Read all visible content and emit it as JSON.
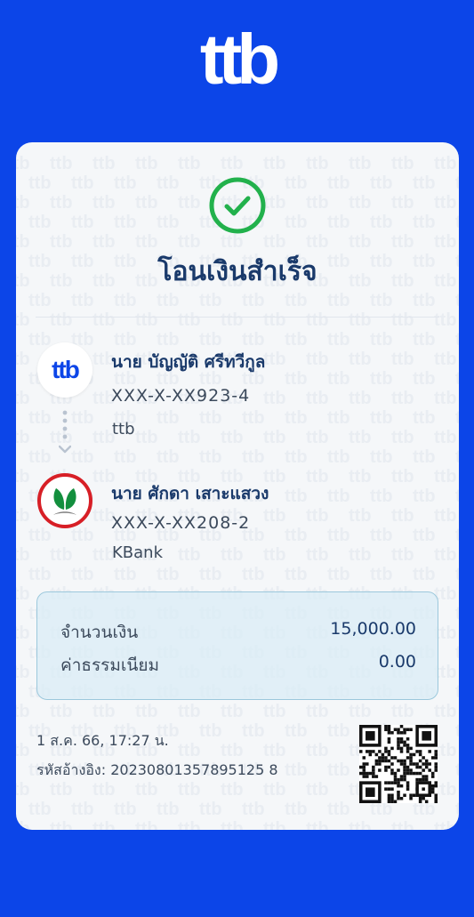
{
  "brand": {
    "logo_text": "ttb",
    "color_background": "#0c45e8",
    "color_title": "#1a3a6b",
    "color_success": "#22b14c"
  },
  "status": {
    "title": "โอนเงินสำเร็จ",
    "icon": "check-circle-icon"
  },
  "sender": {
    "name": "นาย บัญญัติ ศรีทวีกูล",
    "account": "XXX-X-XX923-4",
    "bank": "ttb",
    "logo_text": "ttb"
  },
  "receiver": {
    "name": "นาย ศักดา เสาะแสวง",
    "account": "XXX-X-XX208-2",
    "bank": "KBank"
  },
  "summary": {
    "amount_label": "จำนวนเงิน",
    "amount": "15,000.00",
    "fee_label": "ค่าธรรมเนียม",
    "fee": "0.00"
  },
  "footer": {
    "datetime": "1 ส.ค. 66, 17:27 น.",
    "reference": "รหัสอ้างอิง: 20230801357895125 8"
  }
}
